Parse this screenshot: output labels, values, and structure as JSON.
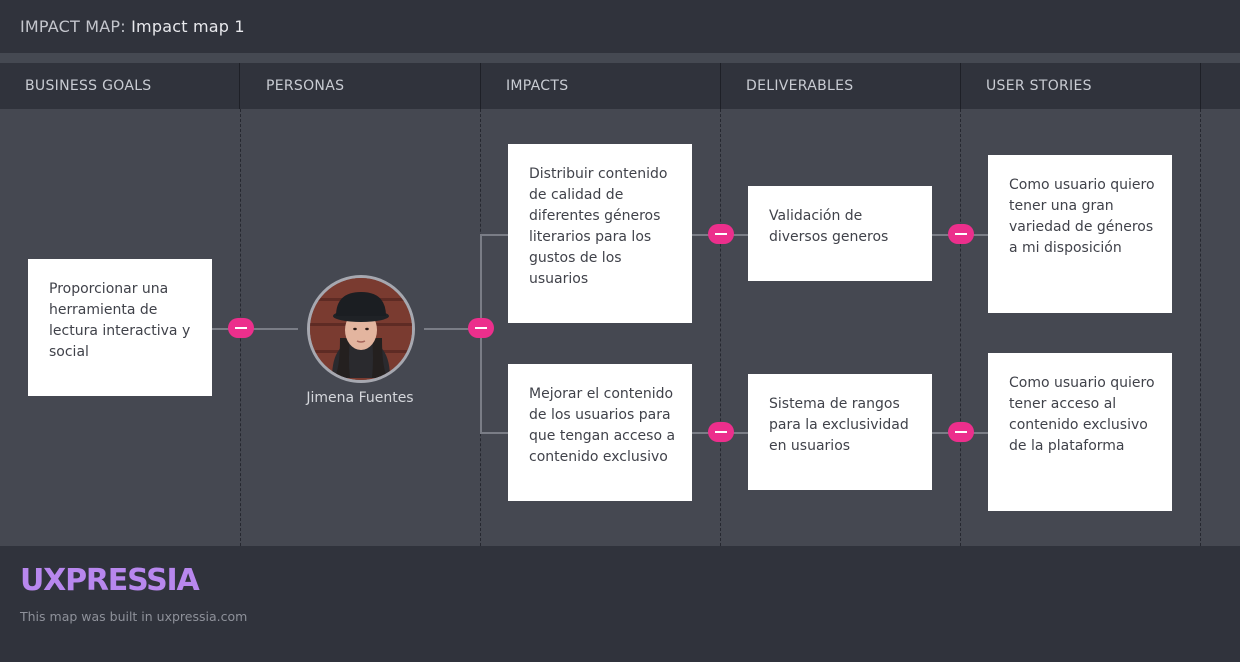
{
  "header": {
    "prefix": "IMPACT MAP:",
    "map_name": "Impact map 1"
  },
  "columns": [
    "BUSINESS GOALS",
    "PERSONAS",
    "IMPACTS",
    "DELIVERABLES",
    "USER STORIES"
  ],
  "business_goal": "Proporcionar una herramienta de lectura interactiva y social",
  "persona": {
    "name": "Jimena Fuentes",
    "avatar": "person-photo"
  },
  "impacts": [
    "Distribuir contenido de calidad de diferentes géneros literarios para los gustos de los usuarios",
    "Mejorar el contenido de los usuarios para que tengan acceso a contenido exclusivo"
  ],
  "deliverables": [
    "Validación de diversos generos",
    "Sistema de rangos para la exclusividad en usuarios"
  ],
  "user_stories": [
    "Como usuario quiero tener una gran variedad de géneros a mi disposición",
    "Como usuario quiero tener acceso al contenido exclusivo de la plataforma"
  ],
  "footer": {
    "logo": "UXPRESSIA",
    "built_text": "This map was built in uxpressia.com"
  },
  "colors": {
    "accent_toggle": "#ec2f8c",
    "logo": "#b887ee",
    "card": "#ffffff"
  }
}
